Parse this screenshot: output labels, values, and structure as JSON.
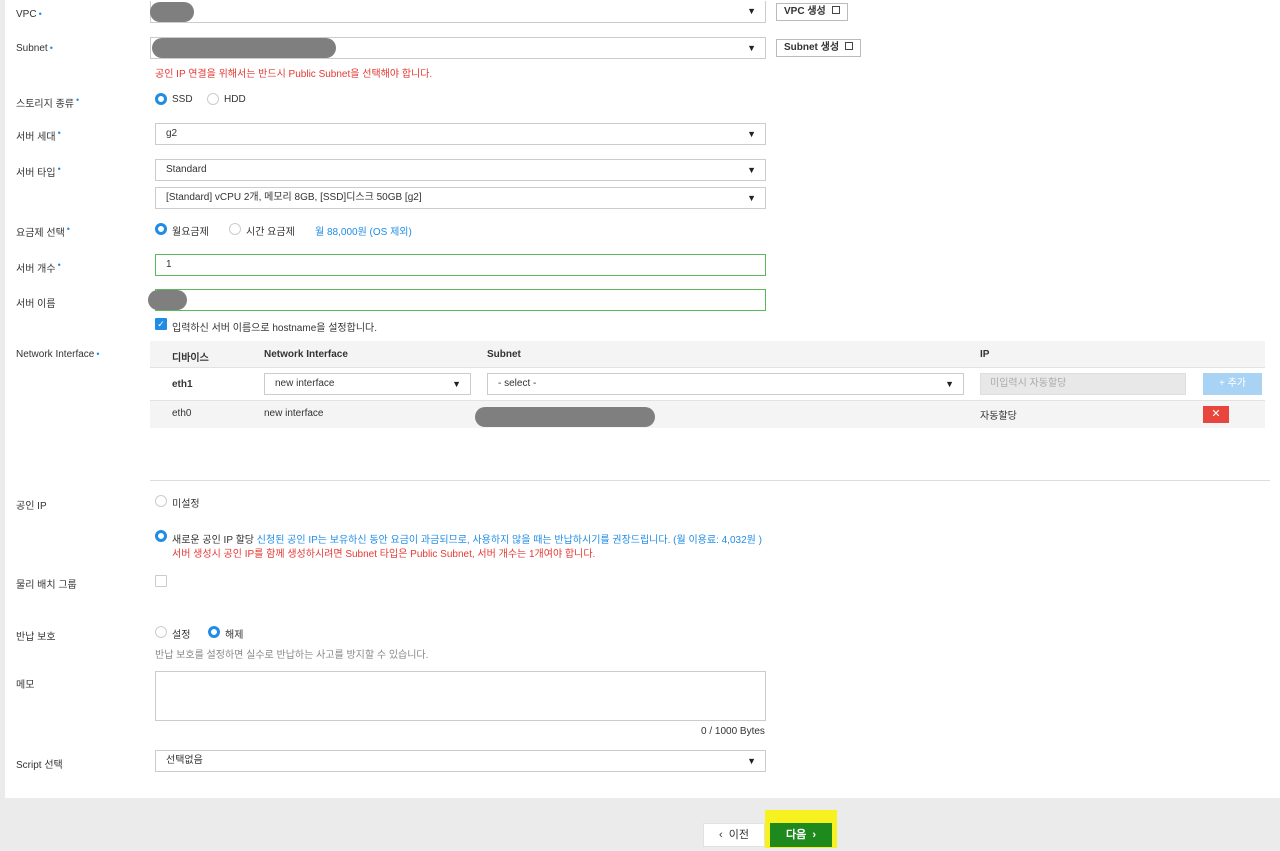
{
  "form": {
    "vpc": {
      "label": "VPC",
      "create_button": "VPC 생성"
    },
    "subnet": {
      "label": "Subnet",
      "create_button": "Subnet 생성",
      "warning": "공인 IP 연결을 위해서는 반드시 Public Subnet을 선택해야 합니다."
    },
    "storage": {
      "label": "스토리지 종류",
      "options": [
        "SSD",
        "HDD"
      ],
      "selected": "SSD"
    },
    "generation": {
      "label": "서버 세대",
      "value": "g2"
    },
    "server_type": {
      "label": "서버 타입",
      "type_value": "Standard",
      "spec_value": "[Standard] vCPU 2개, 메모리 8GB, [SSD]디스크 50GB [g2]"
    },
    "pricing": {
      "label": "요금제 선택",
      "options": [
        "월요금제",
        "시간 요금제"
      ],
      "selected": "월요금제",
      "price_note": "월 88,000원 (OS 제외)"
    },
    "server_count": {
      "label": "서버 개수",
      "value": "1"
    },
    "server_name": {
      "label": "서버 이름",
      "hostname_checkbox": "입력하신 서버 이름으로 hostname을 설정합니다."
    },
    "network_interface": {
      "label": "Network Interface",
      "headers": [
        "디바이스",
        "Network Interface",
        "Subnet",
        "IP"
      ],
      "new_row": {
        "device": "eth1",
        "interface_value": "new interface",
        "subnet_value": "- select -",
        "ip_placeholder": "미입력시 자동할당",
        "add_button": "+ 추가"
      },
      "rows": [
        {
          "device": "eth0",
          "interface": "new interface",
          "ip": "자동할당",
          "delete_icon": "✕"
        }
      ]
    },
    "public_ip": {
      "label": "공인 IP",
      "option_none": "미설정",
      "option_new": "새로운 공인 IP 할당",
      "new_note": "신청된 공인 IP는 보유하신 동안 요금이 과금되므로, 사용하지 않을 때는 반납하시기를 권장드립니다. (월 이용료: 4,032원 )",
      "warning": "서버 생성시 공인 IP를 함께 생성하시려면 Subnet 타입은 Public Subnet, 서버 개수는 1개여야 합니다."
    },
    "placement_group": {
      "label": "물리 배치 그룹"
    },
    "return_protection": {
      "label": "반납 보호",
      "options": [
        "설정",
        "해제"
      ],
      "selected": "해제",
      "help": "반납 보호를 설정하면 실수로 반납하는 사고를 방지할 수 있습니다."
    },
    "memo": {
      "label": "메모",
      "counter": "0 / 1000 Bytes"
    },
    "script": {
      "label": "Script 선택",
      "value": "선택없음"
    }
  },
  "footer": {
    "prev": "이전",
    "next": "다음"
  },
  "colors": {
    "accent": "#1f8ce6",
    "error": "#e53935",
    "next_button": "#1e8a1e",
    "highlight": "#f7f120"
  }
}
